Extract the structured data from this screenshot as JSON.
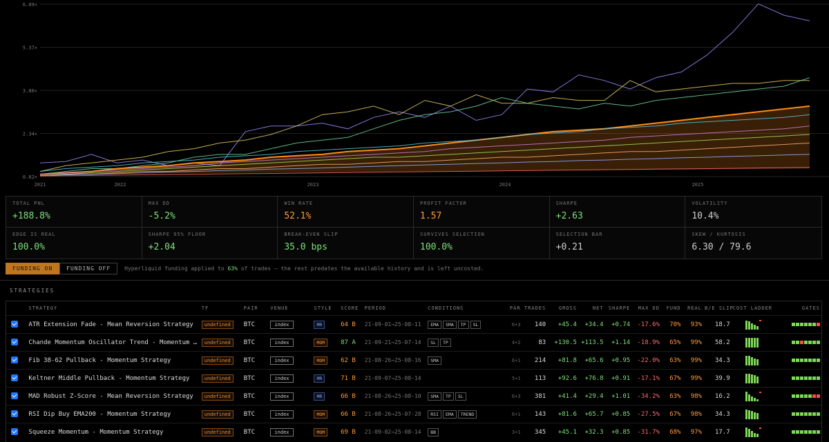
{
  "chart_data": {
    "type": "line",
    "yticks": [
      "6.89×",
      "5.37×",
      "3.86×",
      "2.34×",
      "0.82×"
    ],
    "ylim": [
      0.82,
      6.89
    ],
    "xticks": [
      "2021",
      "2022",
      "2023",
      "2024",
      "2025"
    ],
    "series": [
      {
        "color": "#9b8cff",
        "values": [
          1.3,
          1.35,
          1.6,
          1.3,
          1.4,
          1.2,
          1.3,
          1.2,
          2.4,
          2.6,
          2.6,
          2.7,
          2.5,
          2.9,
          3.1,
          2.9,
          3.3,
          2.8,
          3.0,
          3.9,
          3.8,
          4.4,
          4.2,
          3.9,
          4.3,
          4.5,
          5.1,
          5.9,
          6.9,
          6.5,
          6.3
        ]
      },
      {
        "color": "#e6d060",
        "values": [
          1.0,
          1.2,
          1.3,
          1.4,
          1.5,
          1.7,
          1.8,
          2.0,
          2.1,
          2.3,
          2.6,
          3.0,
          3.1,
          3.3,
          3.0,
          3.5,
          3.3,
          3.7,
          3.4,
          3.4,
          3.6,
          3.5,
          3.5,
          4.2,
          3.8,
          3.9,
          4.0,
          4.1,
          4.1,
          4.2,
          4.2
        ]
      },
      {
        "color": "#6fd8a0",
        "values": [
          0.9,
          1.0,
          1.1,
          1.1,
          1.2,
          1.3,
          1.5,
          1.6,
          1.6,
          1.8,
          2.0,
          2.1,
          2.2,
          2.5,
          2.8,
          3.0,
          3.1,
          3.3,
          3.6,
          3.4,
          3.3,
          3.2,
          3.4,
          3.3,
          3.5,
          3.6,
          3.7,
          3.8,
          3.9,
          4.0,
          4.3
        ]
      },
      {
        "color": "#ff8c1a",
        "values": [
          0.9,
          0.95,
          1.0,
          1.1,
          1.15,
          1.2,
          1.3,
          1.35,
          1.4,
          1.5,
          1.55,
          1.6,
          1.7,
          1.75,
          1.8,
          1.9,
          2.0,
          2.1,
          2.2,
          2.3,
          2.4,
          2.45,
          2.5,
          2.6,
          2.7,
          2.8,
          2.9,
          3.0,
          3.1,
          3.2,
          3.3
        ]
      },
      {
        "color": "#5ac8e8",
        "values": [
          1.0,
          1.1,
          1.15,
          1.2,
          1.3,
          1.35,
          1.4,
          1.5,
          1.55,
          1.6,
          1.7,
          1.75,
          1.8,
          1.85,
          1.9,
          2.0,
          2.05,
          2.1,
          2.2,
          2.3,
          2.35,
          2.4,
          2.5,
          2.55,
          2.6,
          2.7,
          2.75,
          2.8,
          2.85,
          2.9,
          3.0
        ]
      },
      {
        "color": "#d07fd8",
        "values": [
          0.9,
          0.95,
          1.0,
          1.05,
          1.1,
          1.15,
          1.2,
          1.3,
          1.35,
          1.4,
          1.45,
          1.5,
          1.55,
          1.6,
          1.65,
          1.7,
          1.8,
          1.85,
          1.9,
          1.95,
          2.0,
          2.05,
          2.1,
          2.2,
          2.25,
          2.3,
          2.35,
          2.4,
          2.45,
          2.5,
          2.6
        ]
      },
      {
        "color": "#a6e05a",
        "values": [
          0.85,
          0.9,
          0.95,
          1.0,
          1.05,
          1.1,
          1.15,
          1.2,
          1.25,
          1.3,
          1.35,
          1.4,
          1.45,
          1.5,
          1.5,
          1.55,
          1.6,
          1.65,
          1.7,
          1.75,
          1.8,
          1.85,
          1.9,
          1.95,
          2.0,
          2.05,
          2.1,
          2.15,
          2.2,
          2.25,
          2.3
        ]
      },
      {
        "color": "#ffb070",
        "values": [
          0.85,
          0.9,
          0.9,
          0.95,
          1.0,
          1.0,
          1.05,
          1.1,
          1.1,
          1.15,
          1.2,
          1.25,
          1.25,
          1.3,
          1.35,
          1.35,
          1.4,
          1.45,
          1.5,
          1.5,
          1.55,
          1.6,
          1.65,
          1.7,
          1.7,
          1.75,
          1.8,
          1.85,
          1.9,
          1.95,
          2.0
        ]
      },
      {
        "color": "#8fb0ff",
        "values": [
          0.85,
          0.88,
          0.9,
          0.92,
          0.95,
          0.98,
          1.0,
          1.03,
          1.05,
          1.08,
          1.1,
          1.12,
          1.15,
          1.18,
          1.2,
          1.23,
          1.25,
          1.28,
          1.3,
          1.33,
          1.35,
          1.38,
          1.4,
          1.43,
          1.45,
          1.48,
          1.5,
          1.53,
          1.55,
          1.58,
          1.6
        ]
      },
      {
        "color": "#ff6b6b",
        "values": [
          0.84,
          0.85,
          0.86,
          0.87,
          0.88,
          0.89,
          0.9,
          0.91,
          0.92,
          0.93,
          0.94,
          0.95,
          0.96,
          0.97,
          0.98,
          0.99,
          1.0,
          1.01,
          1.02,
          1.03,
          1.04,
          1.05,
          1.06,
          1.07,
          1.08,
          1.09,
          1.1,
          1.11,
          1.12,
          1.13,
          1.14
        ]
      }
    ]
  },
  "metrics": [
    {
      "label": "TOTAL PNL",
      "value": "+188.8%",
      "tone": "pos"
    },
    {
      "label": "MAX DD",
      "value": "-5.2%",
      "tone": "pos"
    },
    {
      "label": "WIN RATE",
      "value": "52.1%",
      "tone": "ora"
    },
    {
      "label": "PROFIT FACTOR",
      "value": "1.57",
      "tone": "ora"
    },
    {
      "label": "SHARPE",
      "value": "+2.63",
      "tone": "pos"
    },
    {
      "label": "VOLATILITY",
      "value": "10.4%",
      "tone": "neu"
    },
    {
      "label": "EDGE IS REAL",
      "value": "100.0%",
      "tone": "pos"
    },
    {
      "label": "SHARPE 95% FLOOR",
      "value": "+2.04",
      "tone": "pos"
    },
    {
      "label": "BREAK-EVEN SLIP",
      "value": "35.0 bps",
      "tone": "pos"
    },
    {
      "label": "SURVIVES SELECTION",
      "value": "100.0%",
      "tone": "pos"
    },
    {
      "label": "SELECTION BAR",
      "value": "+0.21",
      "tone": "neu"
    },
    {
      "label": "SKEW / KURTOSIS",
      "value": "6.30 / 79.6",
      "tone": "neu"
    }
  ],
  "funding": {
    "on_label": "FUNDING ON",
    "off_label": "FUNDING OFF",
    "note_pre": "Hyperliquid funding applied to",
    "note_pct": "63%",
    "note_post": "of trades — the rest predates the available history and is left uncosted."
  },
  "strategies_title": "STRATEGIES",
  "columns": [
    "STRATEGY",
    "TF",
    "PAIR",
    "VENUE",
    "STYLE",
    "SCORE",
    "PERIOD",
    "CONDITIONS",
    "PAR",
    "TRADES",
    "GROSS",
    "NET",
    "SHARPE",
    "MAX DD",
    "FUND",
    "REAL",
    "B/E SLIP",
    "COST LADDER",
    "GATES"
  ],
  "rows": [
    {
      "name": "ATR Extension Fade - Mean Reversion Strategy",
      "tf": "undefined",
      "pair": "BTC",
      "venue": "index",
      "style": "MR",
      "score": "64 B",
      "period": "21-09-01→25-08-11",
      "conds": [
        "EMA",
        "SMA",
        "TP",
        "SL"
      ],
      "par": "6",
      "par_sub": "+3",
      "trades": "140",
      "gross": "+45.4",
      "net": "+34.4",
      "sharpe": "+0.74",
      "maxdd": "-17.6%",
      "fund": "70%",
      "real": "93%",
      "be": "18.7",
      "ladder": [
        9,
        8,
        6,
        5,
        3
      ],
      "ladder_red": true,
      "gates": "ggggggx"
    },
    {
      "name": "Chande Momentum Oscillator Trend - Momentum Strategy",
      "tf": "undefined",
      "pair": "BTC",
      "venue": "index",
      "style": "MOM",
      "score": "87 A",
      "period": "21-09-21→25-07-14",
      "conds": [
        "SL",
        "TP"
      ],
      "par": "4",
      "par_sub": "+2",
      "trades": "83",
      "gross": "+130.5",
      "net": "+113.5",
      "sharpe": "+1.14",
      "maxdd": "-18.9%",
      "fund": "65%",
      "real": "99%",
      "be": "58.2",
      "ladder": [
        10,
        10,
        10,
        10,
        10
      ],
      "ladder_red": false,
      "gates": "ggxgggg"
    },
    {
      "name": "Fib 38-62 Pullback - Momentum Strategy",
      "tf": "undefined",
      "pair": "BTC",
      "venue": "index",
      "style": "MOM",
      "score": "62 B",
      "period": "21-08-26→25-08-16",
      "conds": [
        "SMA"
      ],
      "par": "6",
      "par_sub": "+1",
      "trades": "214",
      "gross": "+81.8",
      "net": "+65.6",
      "sharpe": "+0.95",
      "maxdd": "-22.0%",
      "fund": "63%",
      "real": "99%",
      "be": "34.3",
      "ladder": [
        10,
        10,
        8,
        7,
        6
      ],
      "ladder_red": false,
      "gates": "ggggggg"
    },
    {
      "name": "Keltner Middle Pullback - Momentum Strategy",
      "tf": "undefined",
      "pair": "BTC",
      "venue": "index",
      "style": "MR",
      "score": "71 B",
      "period": "21-09-07→25-08-14",
      "conds": [],
      "par": "5",
      "par_sub": "+1",
      "trades": "113",
      "gross": "+92.6",
      "net": "+76.8",
      "sharpe": "+0.91",
      "maxdd": "-17.1%",
      "fund": "67%",
      "real": "99%",
      "be": "39.9",
      "ladder": [
        10,
        10,
        9,
        8,
        7
      ],
      "ladder_red": false,
      "gates": "ggggggg"
    },
    {
      "name": "MAD Robust Z-Score - Mean Reversion Strategy",
      "tf": "undefined",
      "pair": "BTC",
      "venue": "index",
      "style": "MR",
      "score": "66 B",
      "period": "21-08-26→25-08-10",
      "conds": [
        "SMA",
        "TP",
        "SL"
      ],
      "par": "6",
      "par_sub": "+3",
      "trades": "381",
      "gross": "+41.4",
      "net": "+29.4",
      "sharpe": "+1.01",
      "maxdd": "-34.2%",
      "fund": "63%",
      "real": "98%",
      "be": "16.2",
      "ladder": [
        10,
        7,
        5,
        3,
        2
      ],
      "ladder_red": true,
      "gates": "gggggxx"
    },
    {
      "name": "RSI Dip Buy EMA200 - Momentum Strategy",
      "tf": "undefined",
      "pair": "BTC",
      "venue": "index",
      "style": "MOM",
      "score": "66 B",
      "period": "21-08-26→25-07-28",
      "conds": [
        "RSI",
        "EMA",
        "TREND"
      ],
      "par": "6",
      "par_sub": "+1",
      "trades": "143",
      "gross": "+81.6",
      "net": "+65.7",
      "sharpe": "+0.85",
      "maxdd": "-27.5%",
      "fund": "67%",
      "real": "98%",
      "be": "34.3",
      "ladder": [
        10,
        9,
        8,
        7,
        6
      ],
      "ladder_red": false,
      "gates": "ggggggg"
    },
    {
      "name": "Squeeze Momentum - Momentum Strategy",
      "tf": "undefined",
      "pair": "BTC",
      "venue": "index",
      "style": "MOM",
      "score": "69 B",
      "period": "21-09-02→25-08-14",
      "conds": [
        "BB"
      ],
      "par": "3",
      "par_sub": "+1",
      "trades": "345",
      "gross": "+45.1",
      "net": "+32.3",
      "sharpe": "+0.85",
      "maxdd": "-31.7%",
      "fund": "68%",
      "real": "97%",
      "be": "17.7",
      "ladder": [
        10,
        8,
        6,
        4,
        3
      ],
      "ladder_red": true,
      "gates": "ggggggg"
    }
  ]
}
